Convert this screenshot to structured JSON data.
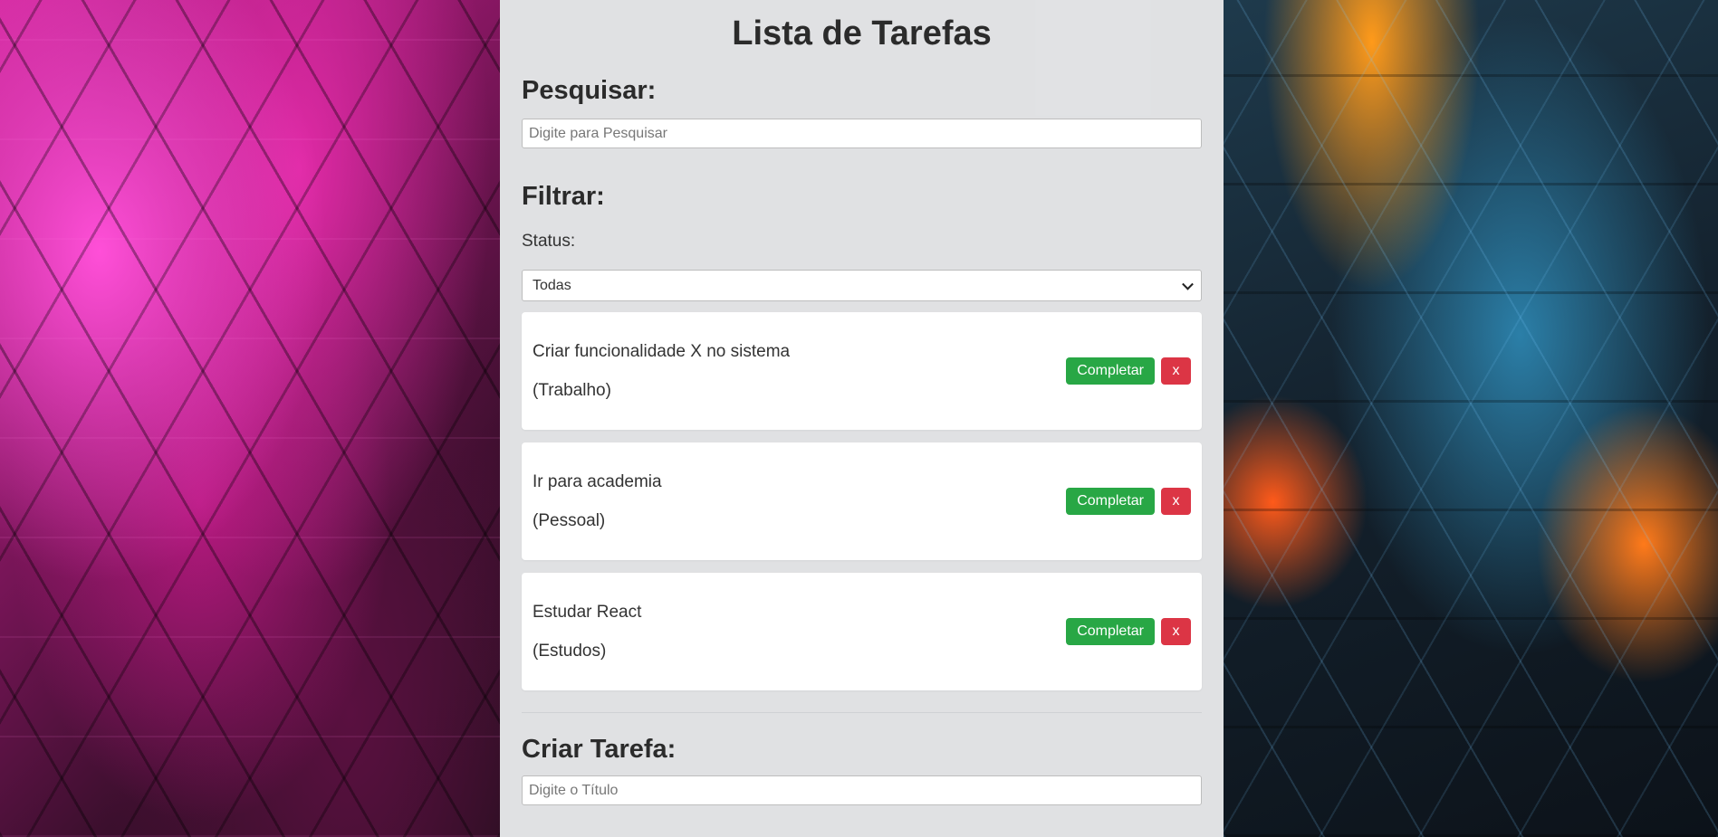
{
  "page": {
    "title": "Lista de Tarefas"
  },
  "search": {
    "heading": "Pesquisar:",
    "placeholder": "Digite para Pesquisar",
    "value": ""
  },
  "filter": {
    "heading": "Filtrar:",
    "status_label": "Status:",
    "selected_option": "Todas"
  },
  "todos": [
    {
      "title": "Criar funcionalidade X no sistema",
      "category": "(Trabalho)",
      "complete_label": "Completar",
      "remove_label": "x"
    },
    {
      "title": "Ir para academia",
      "category": "(Pessoal)",
      "complete_label": "Completar",
      "remove_label": "x"
    },
    {
      "title": "Estudar React",
      "category": "(Estudos)",
      "complete_label": "Completar",
      "remove_label": "x"
    }
  ],
  "create": {
    "heading": "Criar Tarefa:",
    "title_placeholder": "Digite o Título",
    "title_value": ""
  },
  "colors": {
    "complete_button": "#28a745",
    "remove_button": "#dc3545",
    "panel_background": "#f0f1f3"
  }
}
